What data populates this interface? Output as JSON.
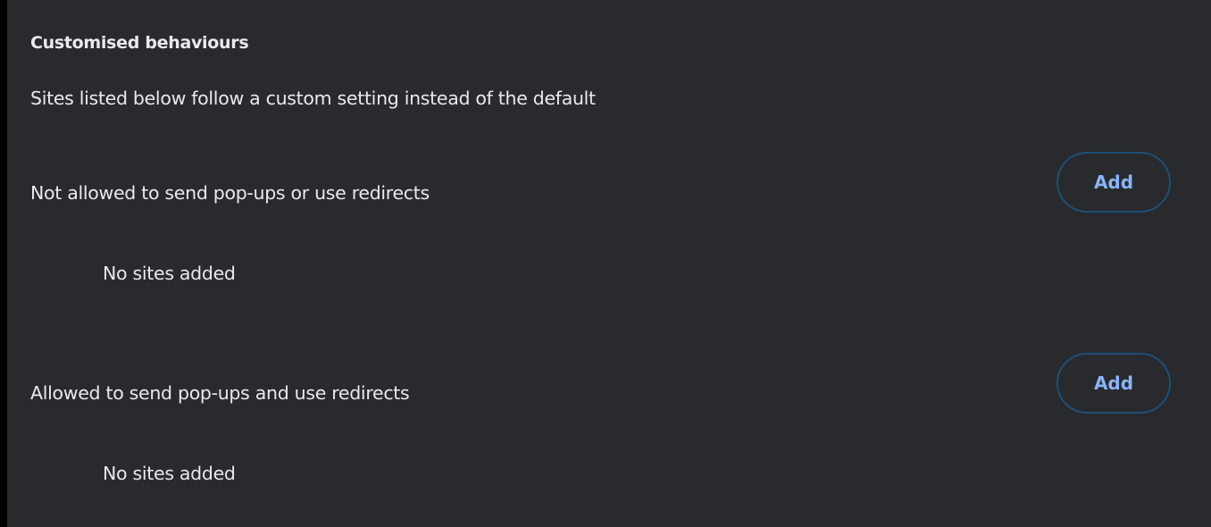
{
  "section": {
    "heading": "Customised behaviours",
    "description": "Sites listed below follow a custom setting instead of the default"
  },
  "lists": [
    {
      "label": "Not allowed to send pop-ups or use redirects",
      "button_label": "Add",
      "empty_text": "No sites added"
    },
    {
      "label": "Allowed to send pop-ups and use redirects",
      "button_label": "Add",
      "empty_text": "No sites added"
    }
  ],
  "colors": {
    "background": "#292a2d",
    "text": "#e8eaed",
    "accent": "#8ab4f8",
    "button_border": "#1f4f78"
  }
}
